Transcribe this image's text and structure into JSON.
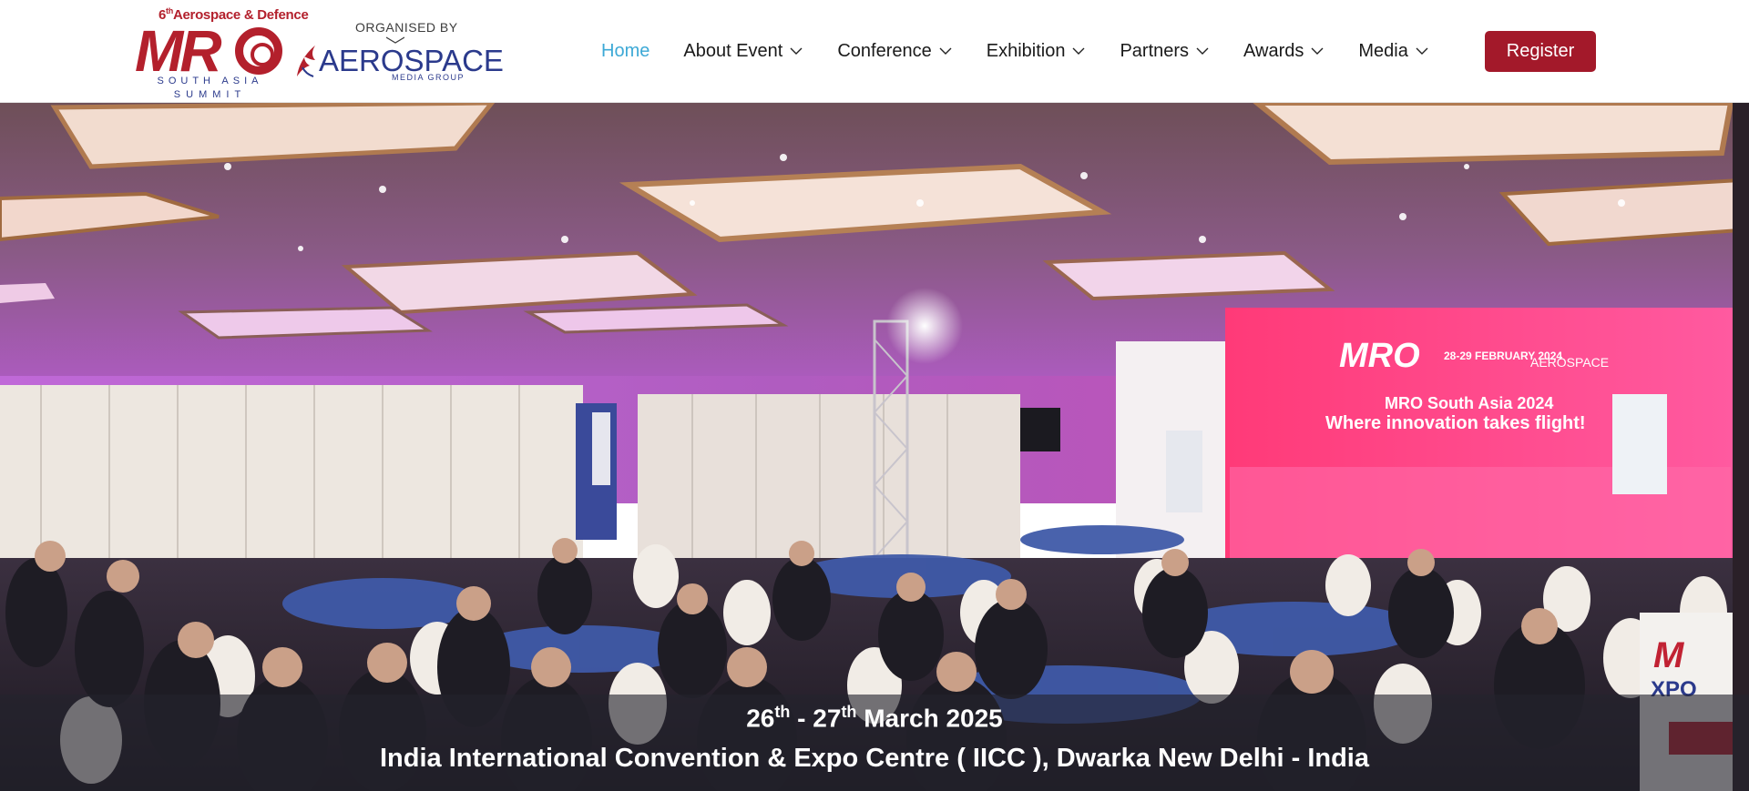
{
  "header": {
    "logo": {
      "edition_number": "6",
      "edition_suffix": "th",
      "edition_text": "Aerospace & Defence",
      "main": "MR",
      "subtitle_line1": "SOUTH ASIA",
      "subtitle_line2": "SUMMIT"
    },
    "organiser": {
      "label": "ORGANISED BY",
      "name": "AEROSPACE",
      "subname": "MEDIA GROUP"
    },
    "nav": [
      {
        "label": "Home",
        "active": true,
        "dropdown": false
      },
      {
        "label": "About Event",
        "active": false,
        "dropdown": true
      },
      {
        "label": "Conference",
        "active": false,
        "dropdown": true
      },
      {
        "label": "Exhibition",
        "active": false,
        "dropdown": true
      },
      {
        "label": "Partners",
        "active": false,
        "dropdown": true
      },
      {
        "label": "Awards",
        "active": false,
        "dropdown": true
      },
      {
        "label": "Media",
        "active": false,
        "dropdown": true
      }
    ],
    "register_label": "Register"
  },
  "hero": {
    "screen_title": "MRO South Asia 2024",
    "screen_tagline": "Where innovation takes flight!",
    "screen_date": "28-29 FEBRUARY 2024",
    "date_day1": "26",
    "date_sup1": "th",
    "date_sep": " - ",
    "date_day2": "27",
    "date_sup2": "th",
    "date_rest": " March 2025",
    "venue": "India International Convention & Expo Centre ( IICC ), Dwarka New Delhi - India"
  },
  "colors": {
    "brand_red": "#a3192a",
    "brand_blue": "#2b3a8c",
    "nav_active": "#3da9d6"
  }
}
